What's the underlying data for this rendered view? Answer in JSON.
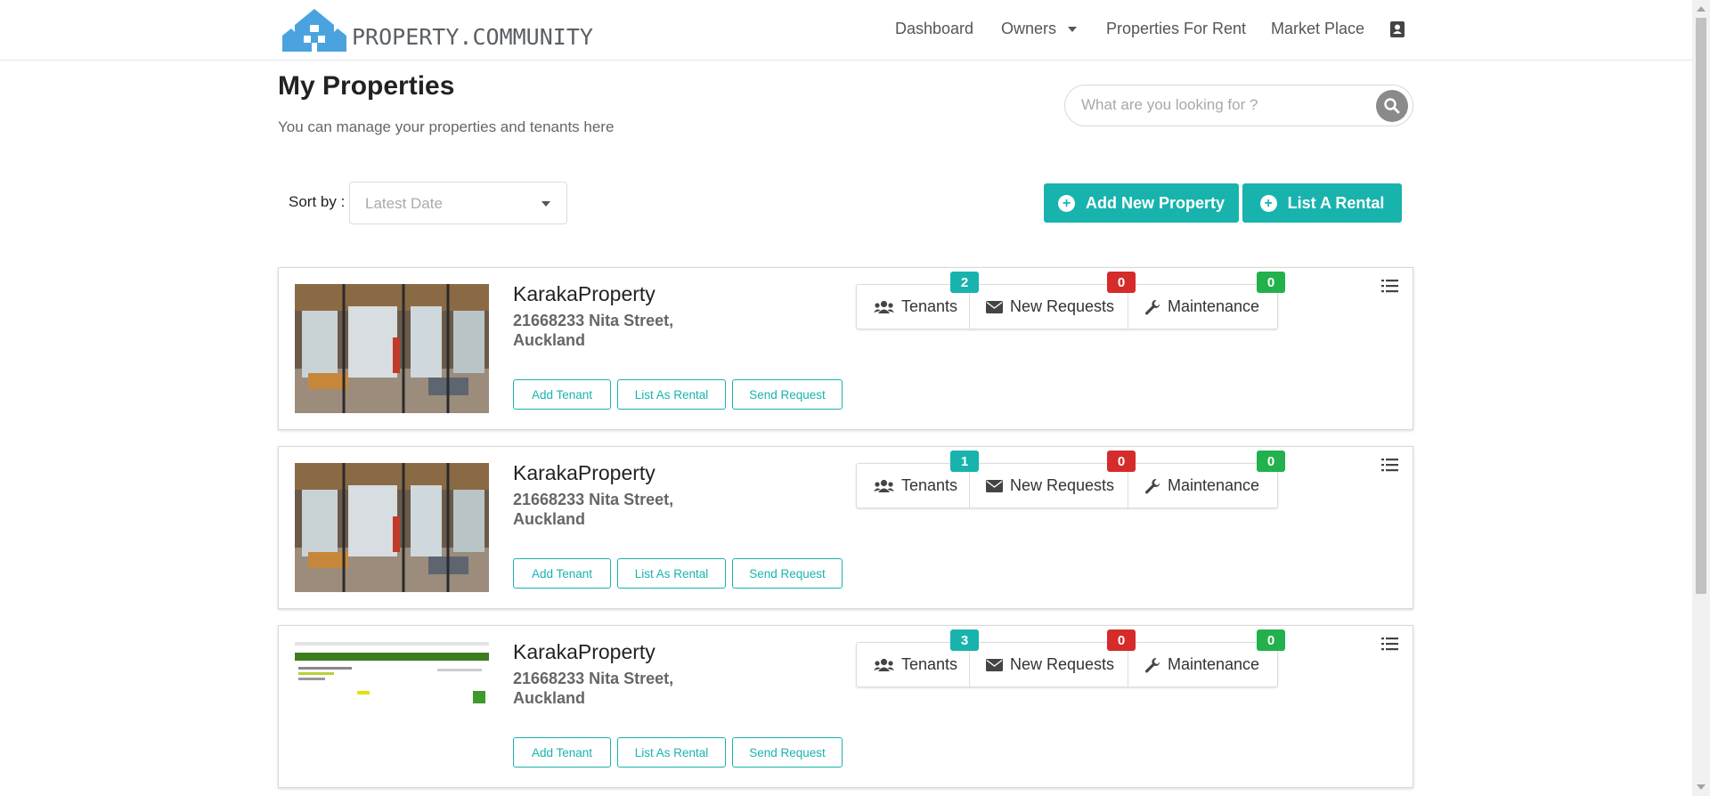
{
  "brand": {
    "name": "PROPERTY.COMMUNITY"
  },
  "nav": {
    "dashboard": "Dashboard",
    "owners": "Owners",
    "properties_for_rent": "Properties For Rent",
    "market_place": "Market Place"
  },
  "header": {
    "title": "My Properties",
    "subtitle": "You can manage your properties and tenants here"
  },
  "search": {
    "placeholder": "What are you looking for ?"
  },
  "sort": {
    "label": "Sort by :",
    "value": "Latest Date"
  },
  "actions": {
    "add_property": "Add New Property",
    "list_rental": "List A Rental"
  },
  "labels": {
    "tenants": "Tenants",
    "new_requests": "New Requests",
    "maintenance": "Maintenance",
    "add_tenant": "Add Tenant",
    "list_as_rental": "List As Rental",
    "send_request": "Send Request"
  },
  "properties": [
    {
      "name": "KarakaProperty",
      "address": "21668233 Nita Street, Auckland",
      "tenants": "2",
      "new_requests": "0",
      "maintenance": "0"
    },
    {
      "name": "KarakaProperty",
      "address": "21668233 Nita Street, Auckland",
      "tenants": "1",
      "new_requests": "0",
      "maintenance": "0"
    },
    {
      "name": "KarakaProperty",
      "address": "21668233 Nita Street, Auckland",
      "tenants": "3",
      "new_requests": "0",
      "maintenance": "0"
    }
  ],
  "colors": {
    "accent": "#19b3ad",
    "badge_red": "#d62b2b",
    "badge_green": "#22b14c",
    "logo_blue": "#4aa3df"
  }
}
